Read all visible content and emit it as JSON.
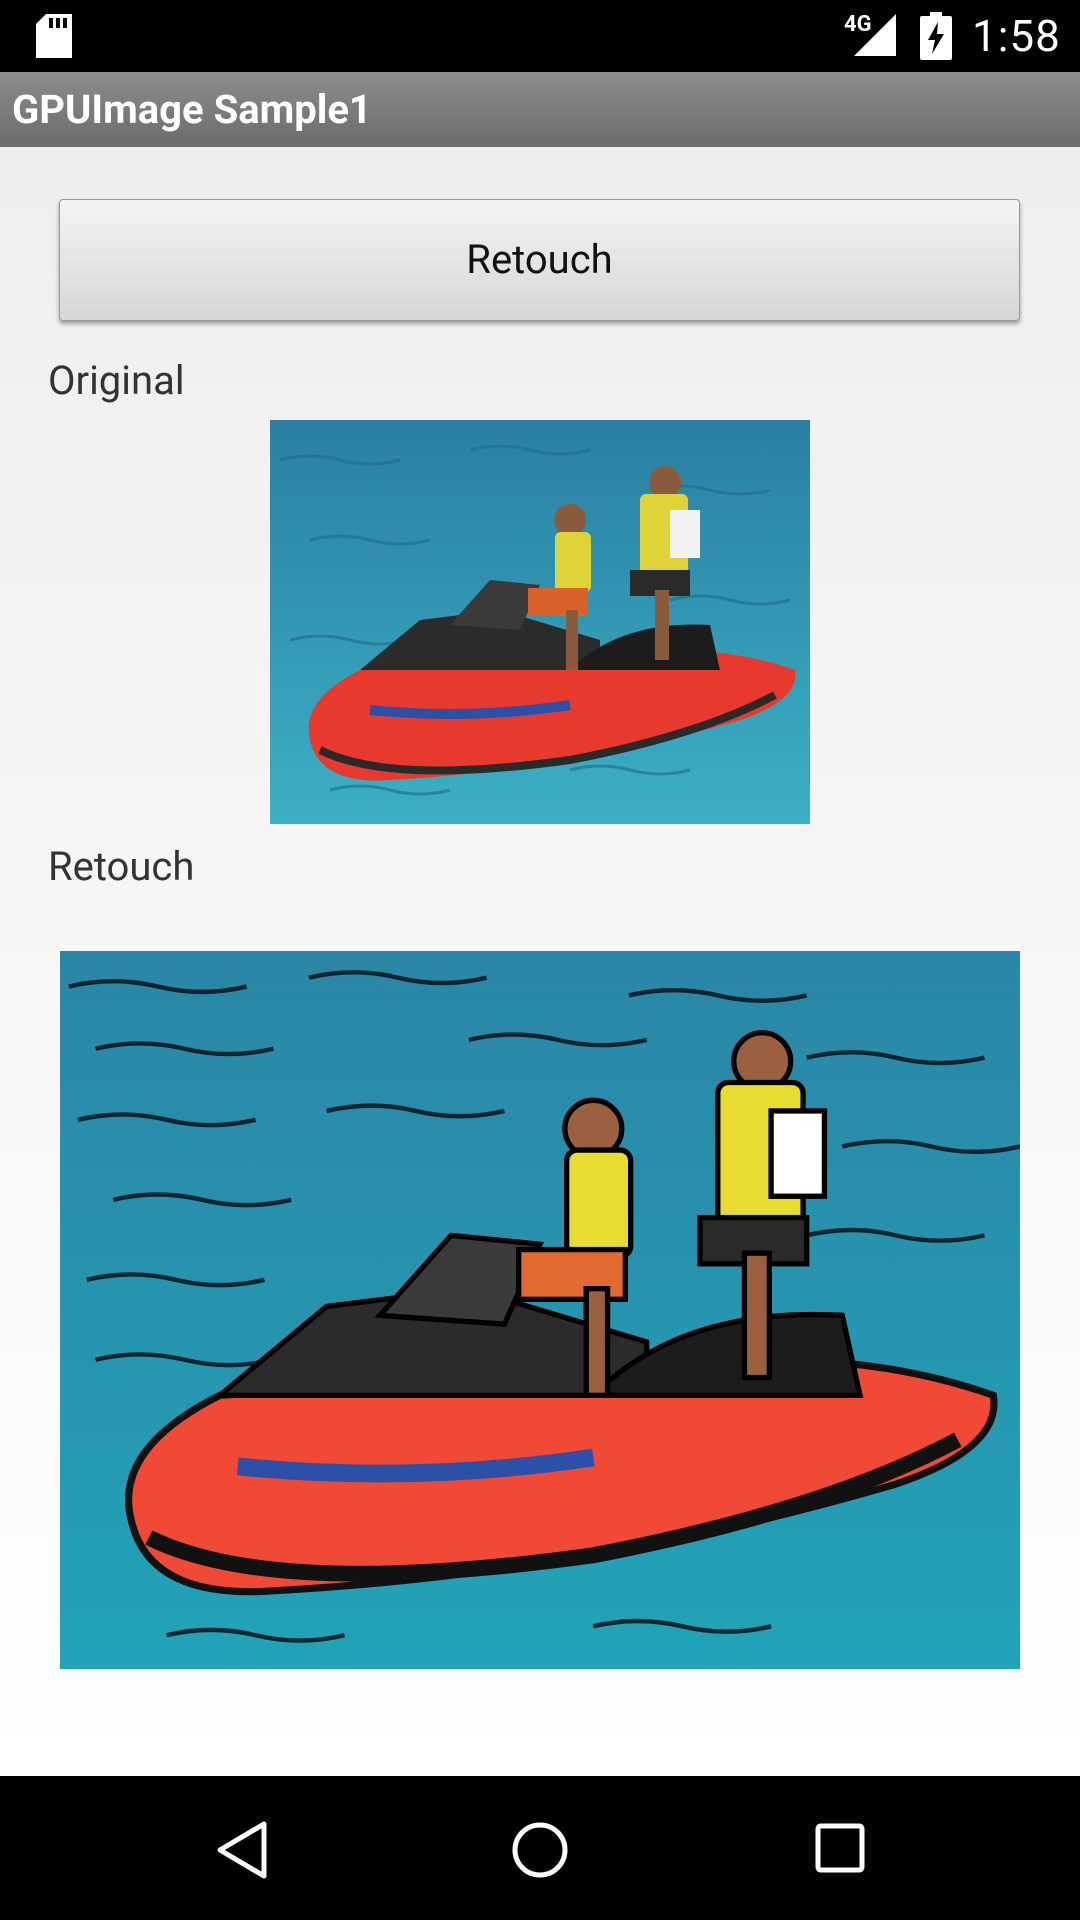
{
  "status_bar": {
    "network": "4G",
    "time": "1:58",
    "icons": [
      "sd-card-icon",
      "signal-icon",
      "battery-charging-icon"
    ]
  },
  "action_bar": {
    "title": "GPUImage Sample1"
  },
  "content": {
    "button_label": "Retouch",
    "original_label": "Original",
    "retouch_label": "Retouch"
  },
  "nav_bar": {
    "icons": [
      "back-icon",
      "home-icon",
      "recents-icon"
    ]
  },
  "colors": {
    "status_bar": "#000000",
    "action_bar": "#7b7b7b",
    "content_bg": "#eeeeee",
    "water": "#2d9bb5",
    "jetski_hull": "#e8392e"
  }
}
